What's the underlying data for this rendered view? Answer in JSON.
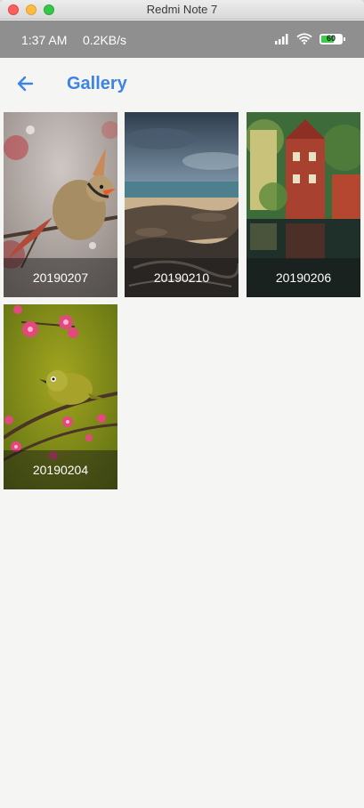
{
  "window": {
    "title": "Redmi Note 7"
  },
  "status_bar": {
    "time": "1:37 AM",
    "speed": "0.2KB/s",
    "battery": "60",
    "icons": [
      "signal-icon",
      "wifi-icon",
      "battery-icon"
    ]
  },
  "app_bar": {
    "title": "Gallery",
    "back_icon": "arrow-left-icon",
    "accent": "#3d83e6"
  },
  "gallery": {
    "items": [
      {
        "label": "20190207",
        "subject": "cardinal bird"
      },
      {
        "label": "20190210",
        "subject": "rocky coastline"
      },
      {
        "label": "20190206",
        "subject": "red house painting"
      },
      {
        "label": "20190204",
        "subject": "bird on plum blossom"
      }
    ]
  }
}
